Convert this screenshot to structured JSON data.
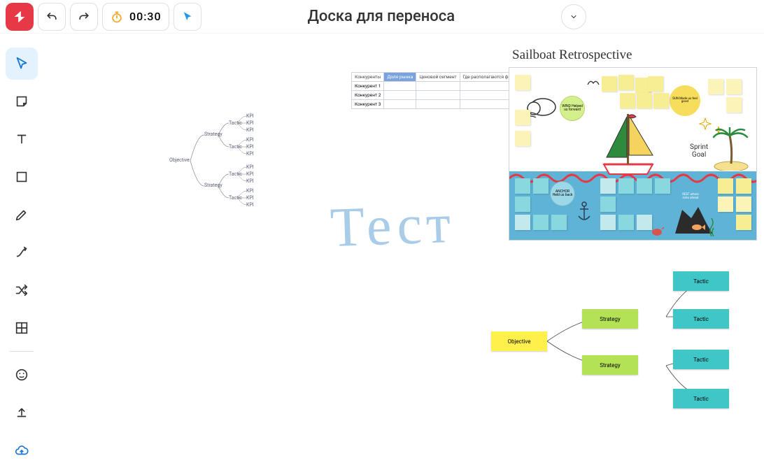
{
  "header": {
    "title": "Доска для переноса",
    "timer": "00:30"
  },
  "mindmap": {
    "root": "Objective",
    "strategy": "Strategy",
    "tactic": "Tactic",
    "kpi": "KPI"
  },
  "table": {
    "h0": "Конкуренты",
    "h1": "Доля рынка",
    "h2": "Ценовой сегмент",
    "h3": "Где располагаются филиалы?",
    "r1": "Конкурент 1",
    "r2": "Конкурент 2",
    "r3": "Конкурент 3"
  },
  "handwrite": "Тест",
  "retro": {
    "title": "Sailboat Retrospective",
    "wind": "WIND Helped us forward",
    "sun": "SUN Made us feel good",
    "anchor": "ANCHOR Held us back",
    "reef": "REEF where risks ahead",
    "sprint_goal1": "Sprint",
    "sprint_goal2": "Goal"
  },
  "diagram": {
    "objective": "Objective",
    "strategy": "Strategy",
    "tactic": "Tactic"
  }
}
